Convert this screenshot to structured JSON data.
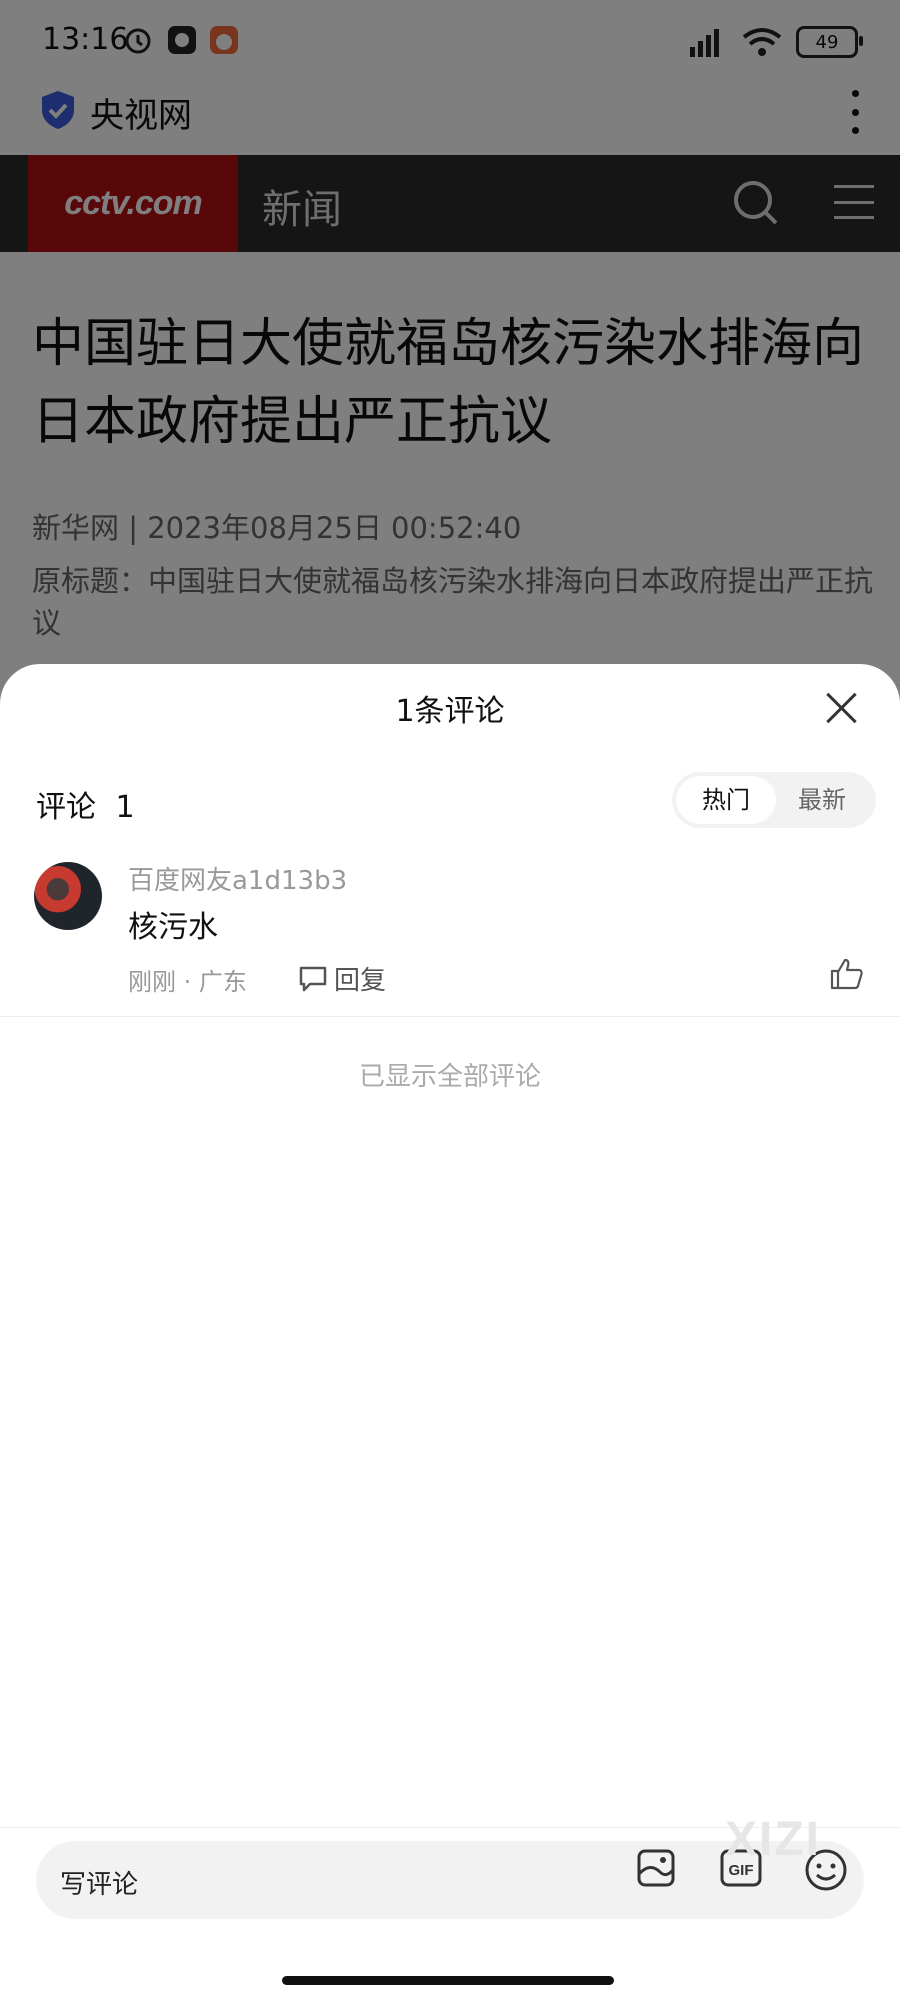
{
  "status": {
    "time": "13:16",
    "battery": "49"
  },
  "browser": {
    "site_name": "央视网"
  },
  "cctv": {
    "logo_text": "cctv.com",
    "logo_cn": "央视网",
    "section": "新闻"
  },
  "article": {
    "title": "中国驻日大使就福岛核污染水排海向日本政府提出严正抗议",
    "meta": "新华网 | 2023年08月25日 00:52:40",
    "subtitle": "原标题：中国驻日大使就福岛核污染水排海向日本政府提出严正抗议"
  },
  "sheet": {
    "title": "1条评论",
    "comments_label": "评论",
    "comments_count": "1",
    "sort": {
      "hot": "热门",
      "new": "最新"
    },
    "comments": [
      {
        "user": "百度网友a1d13b3",
        "text": "核污水",
        "time_location": "刚刚 · 广东",
        "reply_label": "回复"
      }
    ],
    "end_text": "已显示全部评论"
  },
  "input": {
    "placeholder": "写评论",
    "watermark": "XIZI"
  },
  "colors": {
    "cctv_red": "#b21115",
    "nav_dark": "#2a2a2a"
  }
}
